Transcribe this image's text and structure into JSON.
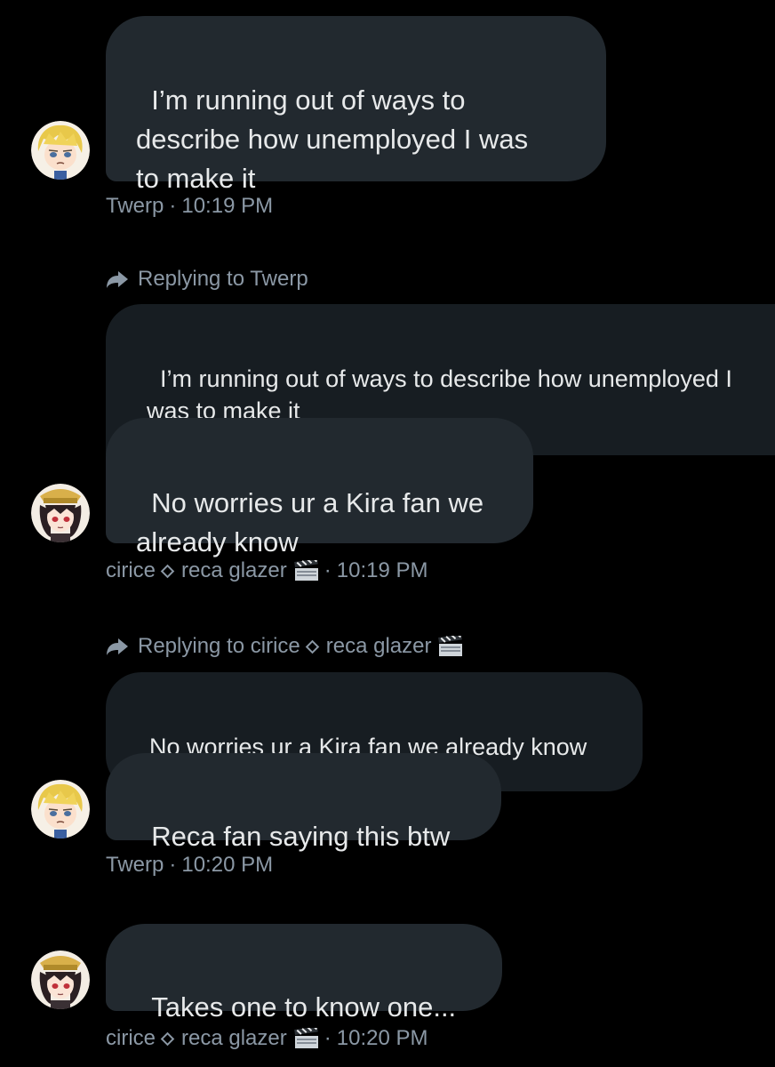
{
  "messages": [
    {
      "text": "I’m running out of ways to\ndescribe how unemployed I was\nto make it",
      "author": "Twerp",
      "time": "10:19 PM"
    },
    {
      "reply_label": "Replying to Twerp",
      "quoted_text": "I’m running out of ways to describe how unemployed I\nwas to make it",
      "text": "No worries ur a Kira fan we\nalready know",
      "author_name": "cirice",
      "author_suffix": "reca glazer",
      "time": "10:19 PM"
    },
    {
      "reply_label_prefix": "Replying to cirice",
      "reply_label_suffix": "reca glazer",
      "quoted_text": "No worries ur a Kira fan we already know",
      "text": "Reca fan saying this btw",
      "author": "Twerp",
      "time": "10:20 PM"
    },
    {
      "text": "Takes one to know one...",
      "author_name": "cirice",
      "author_suffix": "reca glazer",
      "time": "10:20 PM"
    }
  ],
  "separator": "·",
  "colors": {
    "background": "#000000",
    "bubble": "#22292f",
    "quote": "#171d22",
    "meta_text": "#8b98a5",
    "message_text": "#e7e9ea"
  },
  "icons": {
    "avatar_twerp": "blonde-character-avatar-icon",
    "avatar_cirice": "dark-haired-character-avatar-icon",
    "reply": "reply-arrow-icon",
    "diamond": "diamond-icon",
    "clapper": "clapperboard-icon"
  }
}
